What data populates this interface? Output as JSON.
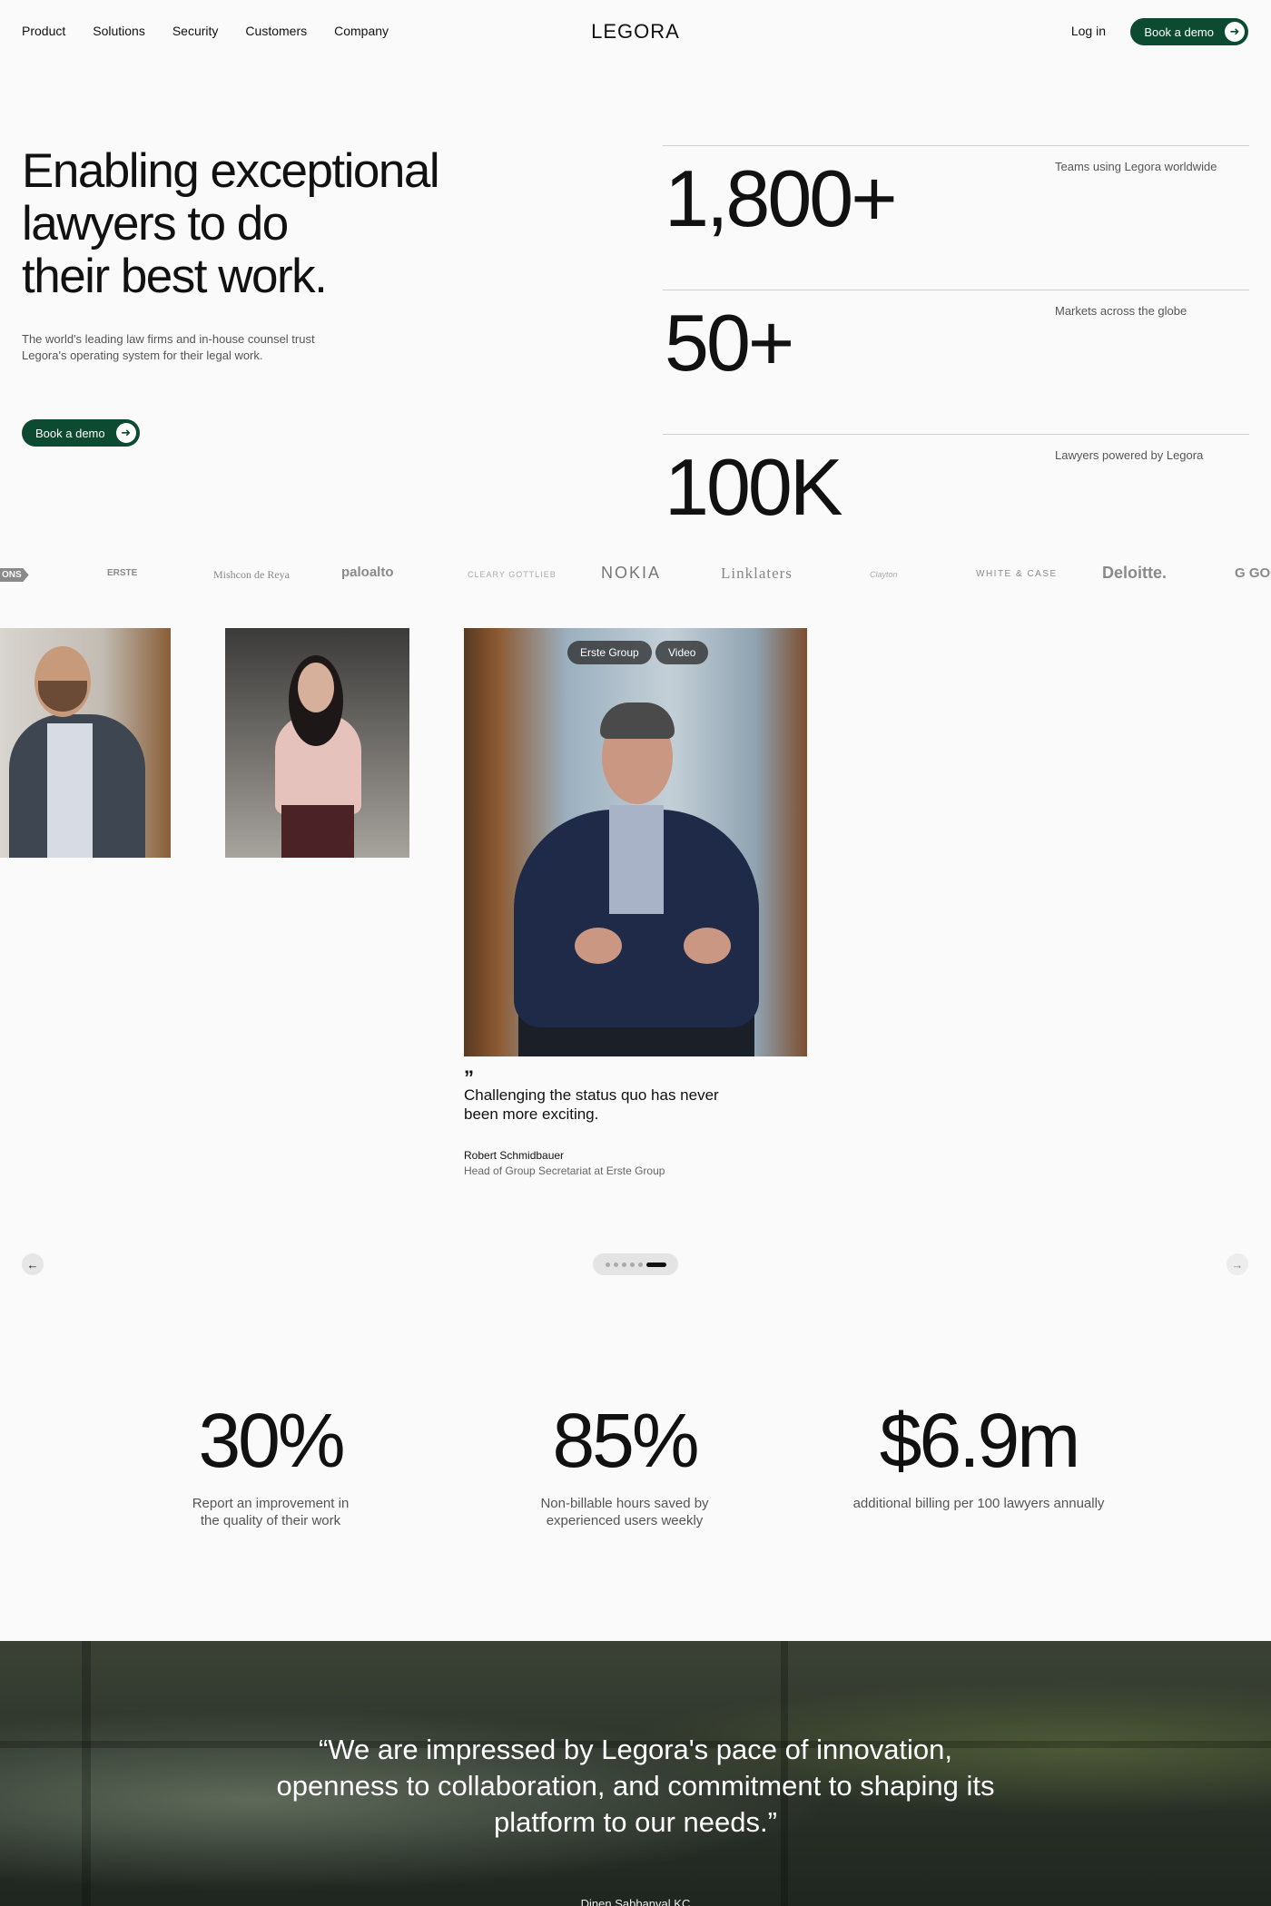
{
  "nav": {
    "links": [
      "Product",
      "Solutions",
      "Security",
      "Customers",
      "Company"
    ],
    "logo": "LEGORA",
    "login": "Log in",
    "demo": "Book a demo"
  },
  "hero": {
    "title_line1": "Enabling exceptional",
    "title_line2": "lawyers to do",
    "title_line3": "their best work.",
    "subtitle": "The world's leading law firms and in-house counsel trust Legora's operating system for their legal work.",
    "demo": "Book a demo"
  },
  "stats": [
    {
      "value": "1,800+",
      "label": "Teams using Legora worldwide"
    },
    {
      "value": "50+",
      "label": "Markets across the globe"
    },
    {
      "value": "100K",
      "label": "Lawyers powered by Legora"
    }
  ],
  "logos": [
    "ONS",
    "ERSTE",
    "Mishcon de Reya",
    "paloalto",
    "CLEARY GOTTLIEB",
    "NOKIA",
    "Linklaters",
    "Clayton",
    "WHITE & CASE",
    "Deloitte.",
    "G GOO"
  ],
  "carousel": {
    "tags": [
      "Erste Group",
      "Video"
    ],
    "quote_mark": "”",
    "quote": "Challenging the status quo has never been more exciting.",
    "author": "Robert Schmidbauer",
    "role": "Head of Group Secretariat at Erste Group",
    "prev_icon": "arrow-left-icon",
    "next_icon": "arrow-right-icon",
    "pages": 6,
    "active_page": 6
  },
  "metrics": [
    {
      "value": "30%",
      "label": "Report an improvement in the quality of their work"
    },
    {
      "value": "85%",
      "label": "Non-billable hours saved by experienced users weekly"
    },
    {
      "value": "$6.9m",
      "label": "additional billing per 100 lawyers annually"
    }
  ],
  "testimonial": {
    "quote": "“We are impressed by Legora's pace of innovation, openness to collaboration, and commitment to shaping its platform to our needs.”",
    "author": "Dinen Sabbanval KC"
  },
  "colors": {
    "accent": "#0c4a32",
    "background": "#fafafa"
  }
}
